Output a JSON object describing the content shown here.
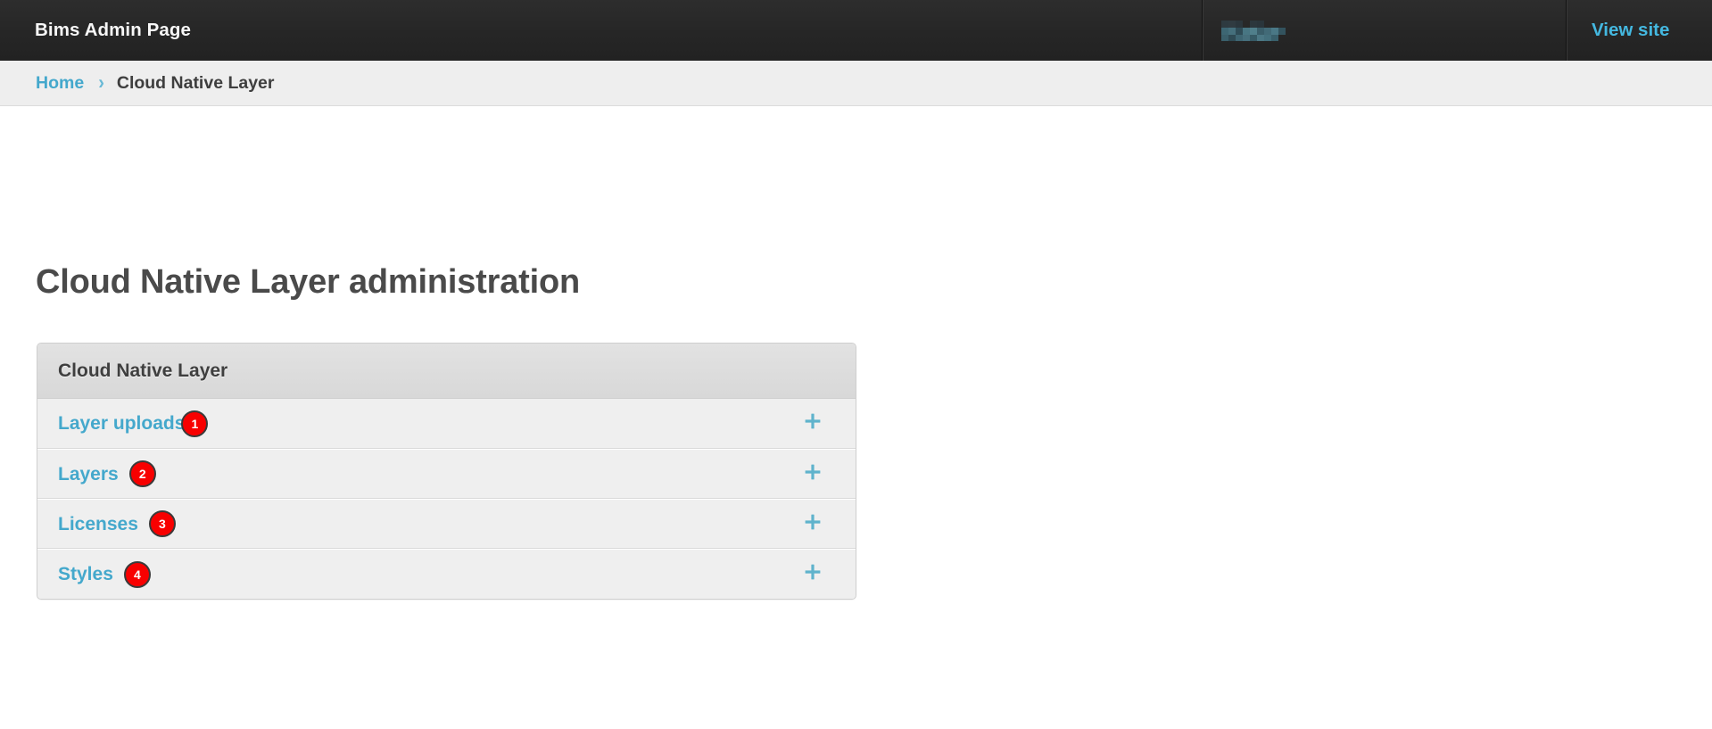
{
  "header": {
    "brand_title": "Bims Admin Page",
    "user_redacted_label": "redacted-username",
    "view_site_label": "View site"
  },
  "breadcrumbs": {
    "home_label": "Home",
    "separator": "›",
    "current_label": "Cloud Native Layer"
  },
  "page": {
    "title": "Cloud Native Layer administration"
  },
  "app_panel": {
    "caption": "Cloud Native Layer",
    "add_icon_label": "+",
    "models": [
      {
        "label": "Layer uploads",
        "badge": "1",
        "add_icon": "plus-icon",
        "badge_spacing": "tight"
      },
      {
        "label": "Layers",
        "badge": "2",
        "add_icon": "plus-icon",
        "badge_spacing": "gap"
      },
      {
        "label": "Licenses",
        "badge": "3",
        "add_icon": "plus-icon",
        "badge_spacing": "gap"
      },
      {
        "label": "Styles",
        "badge": "4",
        "add_icon": "plus-icon",
        "badge_spacing": "gap"
      }
    ]
  },
  "colors": {
    "header_bg": "#262626",
    "link_blue": "#44a8cc",
    "view_site_blue": "#44b8e0",
    "badge_red": "#f80000",
    "breadcrumb_bg": "#eeeeee",
    "panel_bg": "#efefef",
    "panel_header_bg": "#d8d8d8",
    "title_gray": "#4a4a4a"
  }
}
